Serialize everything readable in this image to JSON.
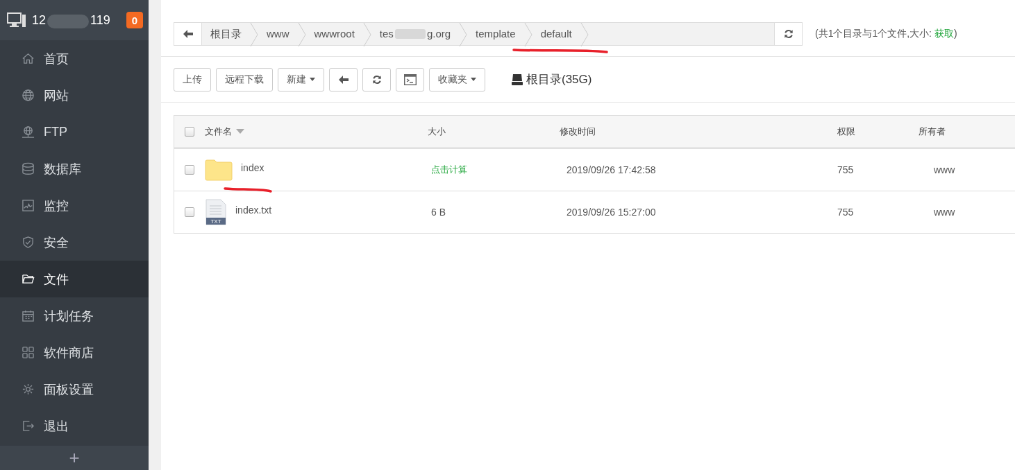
{
  "header": {
    "host_start": "12",
    "host_end": "119",
    "badge": "0"
  },
  "sidebar": {
    "items": [
      {
        "label": "首页",
        "selected": false
      },
      {
        "label": "网站",
        "selected": false
      },
      {
        "label": "FTP",
        "selected": false
      },
      {
        "label": "数据库",
        "selected": false
      },
      {
        "label": "监控",
        "selected": false
      },
      {
        "label": "安全",
        "selected": false
      },
      {
        "label": "文件",
        "selected": true
      },
      {
        "label": "计划任务",
        "selected": false
      },
      {
        "label": "软件商店",
        "selected": false
      },
      {
        "label": "面板设置",
        "selected": false
      },
      {
        "label": "退出",
        "selected": false
      }
    ],
    "add": "+"
  },
  "breadcrumb": {
    "items": [
      {
        "text": "根目录",
        "annotated": false
      },
      {
        "text": "www",
        "annotated": false
      },
      {
        "text": "wwwroot",
        "annotated": false
      },
      {
        "text": "tes",
        "text_end": "g.org",
        "annotated": false
      },
      {
        "text": "template",
        "annotated": false
      },
      {
        "text": "default",
        "annotated": true
      }
    ],
    "summary": "(共1个目录与1个文件,大小: ",
    "summary_link": "获取",
    "summary_end": ")"
  },
  "toolbar": {
    "buttons": [
      {
        "kind": "text",
        "label": "上传"
      },
      {
        "kind": "text",
        "label": "远程下载"
      },
      {
        "kind": "dropdown",
        "label": "新建"
      },
      {
        "kind": "back"
      },
      {
        "kind": "refresh"
      },
      {
        "kind": "terminal"
      },
      {
        "kind": "dropdown",
        "label": "收藏夹"
      }
    ],
    "disk": "根目录(35G)"
  },
  "table": {
    "columns": [
      "文件名",
      "大小",
      "修改时间",
      "权限",
      "所有者"
    ],
    "all_checked": false,
    "rows": [
      {
        "kind": "folder",
        "name": "index",
        "size": "点击计算",
        "size_link": true,
        "time": "2019/09/26 17:42:58",
        "perm": "755",
        "owner": "www",
        "checked": false,
        "annotated": true
      },
      {
        "kind": "txt",
        "icon_label": "TXT",
        "name": "index.txt",
        "size": "6 B",
        "size_link": false,
        "time": "2019/09/26 15:27:00",
        "perm": "755",
        "owner": "www",
        "checked": false,
        "annotated": false
      }
    ]
  }
}
